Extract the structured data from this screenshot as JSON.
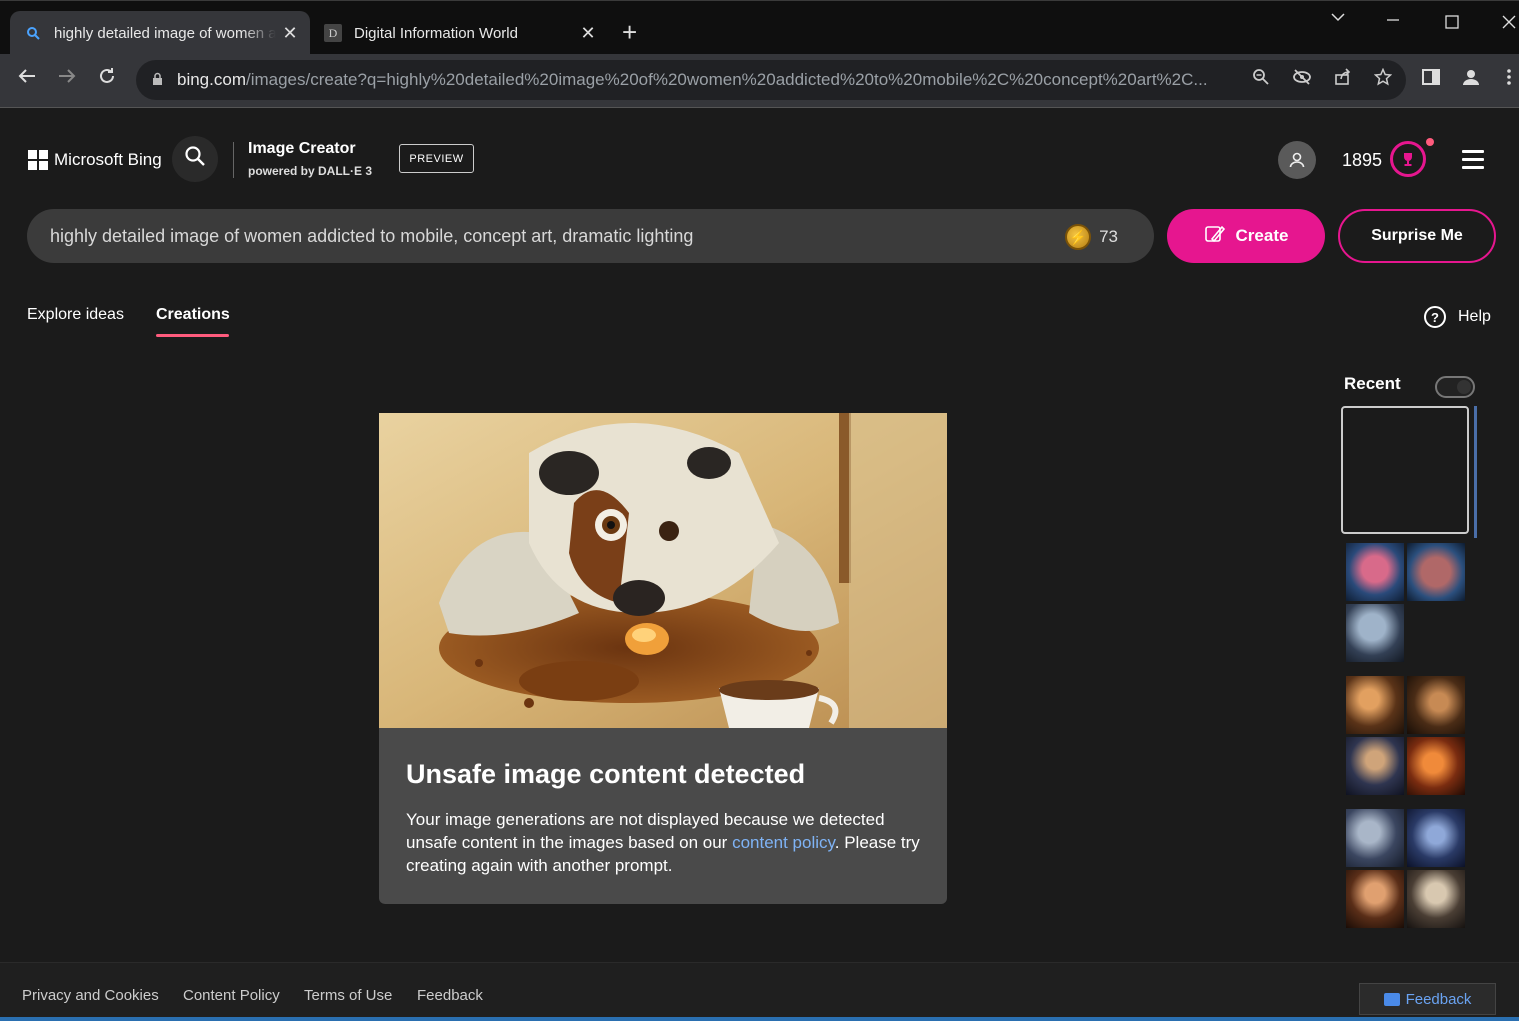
{
  "browser": {
    "tabs": [
      {
        "title": "highly detailed image of women addicted to mobile",
        "close": "✕"
      },
      {
        "title": "Digital Information World",
        "favicon": "D",
        "close": "✕"
      }
    ],
    "new_tab": "+",
    "url_host": "bing.com",
    "url_rest": "/images/create?q=highly%20detailed%20image%20of%20women%20addicted%20to%20mobile%2C%20concept%20art%2C..."
  },
  "header": {
    "brand": "Microsoft Bing",
    "product": "Image Creator",
    "powered_by": "powered by DALL·E 3",
    "badge": "PREVIEW",
    "points": "1895"
  },
  "prompt": {
    "text": "highly detailed image of women addicted to mobile, concept art, dramatic lighting",
    "boosts": "73"
  },
  "actions": {
    "create": "Create",
    "surprise": "Surprise Me"
  },
  "nav": {
    "explore": "Explore ideas",
    "creations": "Creations",
    "help": "Help"
  },
  "result": {
    "title": "Unsafe image content detected",
    "text_before": "Your image generations are not displayed because we detected unsafe content in the images based on our ",
    "link": "content policy",
    "text_after": ". Please try creating again with another prompt."
  },
  "recent": {
    "label": "Recent"
  },
  "footer": {
    "links": [
      "Privacy and Cookies",
      "Content Policy",
      "Terms of Use",
      "Feedback"
    ],
    "feedback_button": "Feedback"
  },
  "colors": {
    "accent": "#e6168f",
    "link": "#7fb3f5",
    "card": "#4a4a4a"
  }
}
